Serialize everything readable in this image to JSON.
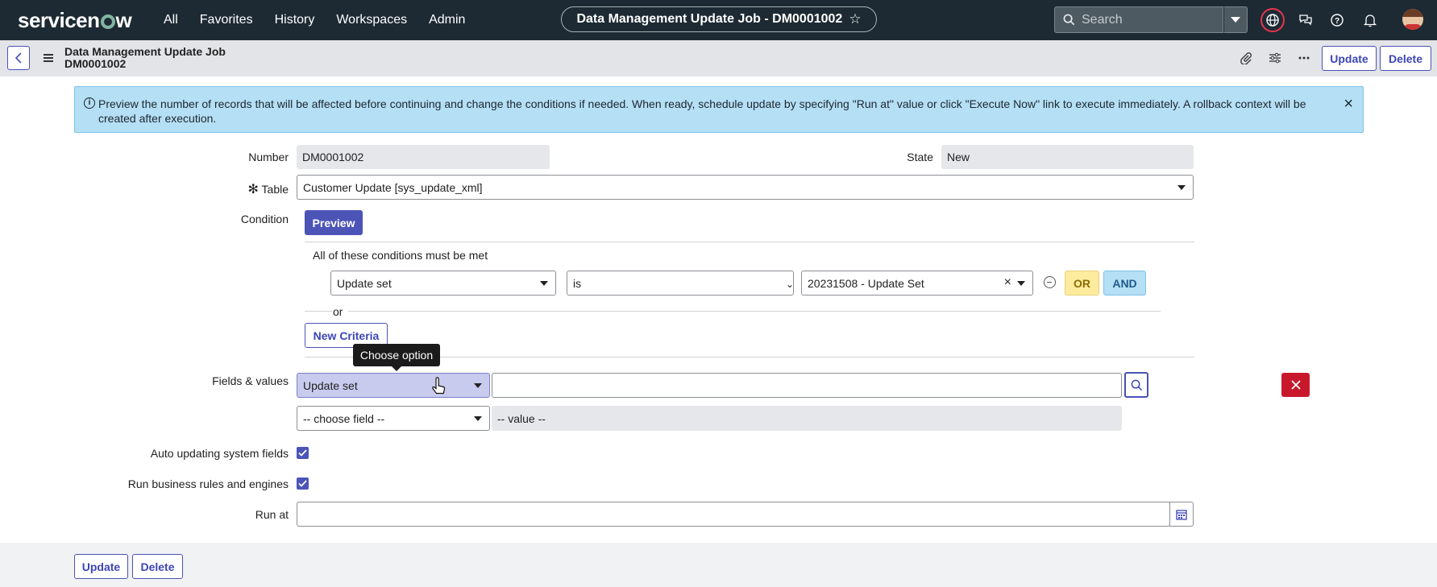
{
  "topnav": {
    "logo": "servicenow",
    "links": [
      "All",
      "Favorites",
      "History",
      "Workspaces",
      "Admin"
    ],
    "record_title": "Data Management Update Job - DM0001002",
    "search_placeholder": "Search",
    "icons": [
      "globe-icon",
      "chat-icon",
      "help-icon",
      "bell-icon"
    ]
  },
  "header": {
    "title_line1": "Data Management Update Job",
    "title_line2": "DM0001002",
    "update_label": "Update",
    "delete_label": "Delete"
  },
  "banner": {
    "text": "Preview the number of records that will be affected before continuing and change the conditions if needed. When ready, schedule update by specifying \"Run at\" value or click \"Execute Now\" link to execute immediately. A rollback context will be created after execution."
  },
  "form": {
    "number_label": "Number",
    "number_value": "DM0001002",
    "state_label": "State",
    "state_value": "New",
    "table_label": "Table",
    "table_value": "Customer Update [sys_update_xml]",
    "condition_label": "Condition",
    "preview_label": "Preview",
    "conditions_heading": "All of these conditions must be met",
    "condition_field": "Update set",
    "condition_operator": "is",
    "condition_value": "20231508 - Update Set",
    "or_label": "OR",
    "and_label": "AND",
    "or_separator": "or",
    "new_criteria_label": "New Criteria",
    "tooltip": "Choose option",
    "fields_values_label": "Fields & values",
    "field1": "Update set",
    "field2_placeholder": "-- choose field --",
    "value2_placeholder": "-- value --",
    "auto_updating_label": "Auto updating system fields",
    "auto_updating_checked": true,
    "run_business_label": "Run business rules and engines",
    "run_business_checked": true,
    "run_at_label": "Run at",
    "run_at_value": ""
  },
  "footer": {
    "update_label": "Update",
    "delete_label": "Delete"
  },
  "colors": {
    "nav_bg": "#1d2a33",
    "accent": "#4c54b8",
    "banner_bg": "#b5dff5",
    "danger": "#c8192c",
    "or_bg": "#fdeb9e",
    "and_bg": "#b5dff5"
  }
}
